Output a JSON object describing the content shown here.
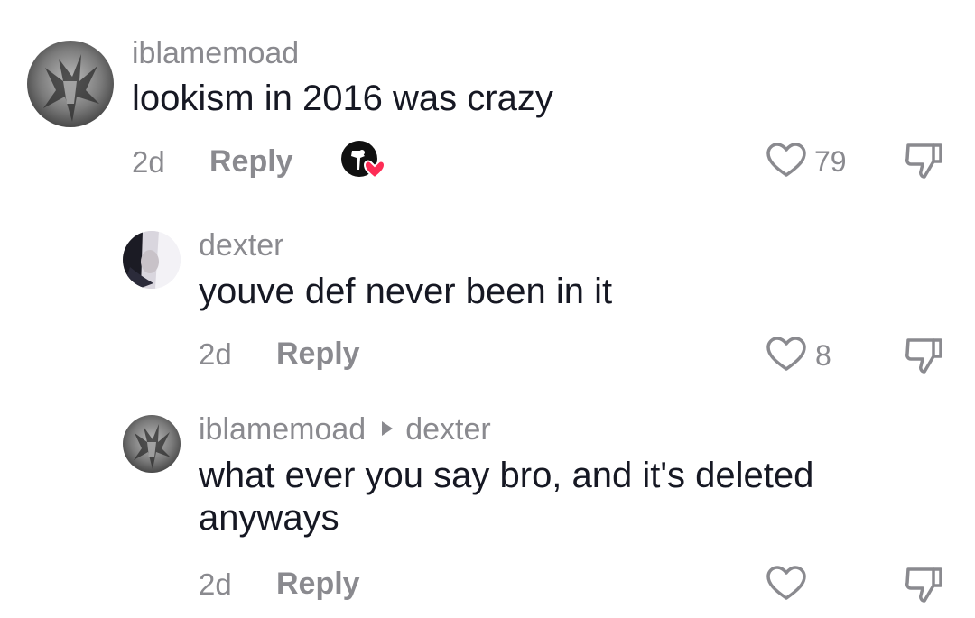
{
  "comments": [
    {
      "username": "iblamemoad",
      "text": "lookism in 2016 was crazy",
      "time": "2d",
      "reply_label": "Reply",
      "likes": "79",
      "creator_liked": true
    },
    {
      "username": "dexter",
      "text": "youve def never been in it",
      "time": "2d",
      "reply_label": "Reply",
      "likes": "8"
    },
    {
      "username": "iblamemoad",
      "reply_to": "dexter",
      "text": "what ever you say bro, and it's deleted anyways",
      "time": "2d",
      "reply_label": "Reply",
      "likes": ""
    }
  ],
  "icons": {
    "like": "heart-outline-icon",
    "dislike": "thumbs-down-icon",
    "creator_badge": "creator-liked-heart-icon",
    "reply_arrow": "right-triangle-icon"
  },
  "colors": {
    "secondary_text": "#8a8a8f",
    "primary_text": "#161823",
    "badge_heart": "#fe2c55"
  }
}
